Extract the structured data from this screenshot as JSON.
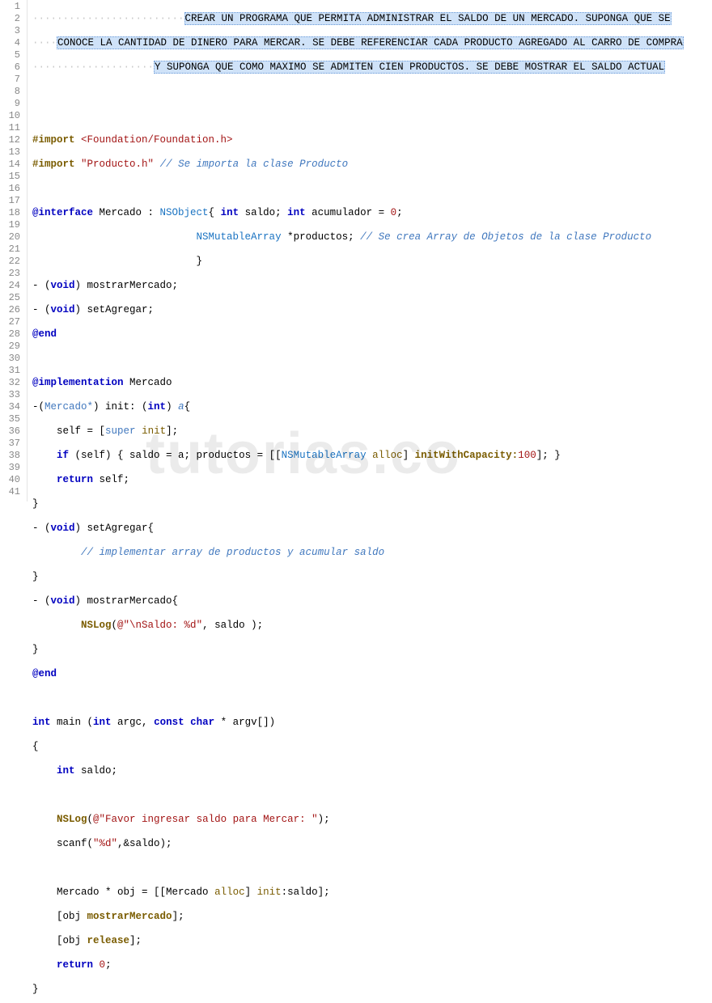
{
  "watermark": "tutorias.co",
  "gutter": {
    "start": 1,
    "end": 41
  },
  "comment_lines": [
    "CREAR UN PROGRAMA QUE PERMITA ADMINISTRAR EL SALDO DE UN MERCADO. SUPONGA QUE SE",
    "CONOCE LA CANTIDAD DE DINERO PARA MERCAR. SE DEBE REFERENCIAR CADA PRODUCTO AGREGADO AL CARRO DE COMPRA",
    "Y SUPONGA QUE COMO MAXIMO SE ADMITEN CIEN PRODUCTOS. SE DEBE MOSTRAR EL SALDO ACTUAL"
  ],
  "code": {
    "l6_import": "#import",
    "l6_header": "<Foundation/Foundation.h>",
    "l7_import": "#import",
    "l7_header": "\"Producto.h\"",
    "l7_cmt": "// Se importa la clase Producto",
    "l9_a": "@interface",
    "l9_b": " Mercado : ",
    "l9_c": "NSObject",
    "l9_d": "{ ",
    "l9_e": "int",
    "l9_f": " saldo; ",
    "l9_g": "int",
    "l9_h": " acumulador = ",
    "l9_i": "0",
    "l9_j": ";",
    "l10_a": "NSMutableArray",
    "l10_b": " *productos; ",
    "l10_c": "// Se crea Array de Objetos de la clase Producto",
    "l11": "}",
    "l12_a": "- (",
    "l12_b": "void",
    "l12_c": ") mostrarMercado;",
    "l13_a": "- (",
    "l13_b": "void",
    "l13_c": ") setAgregar;",
    "l14": "@end",
    "l16": "@implementation",
    "l16b": " Mercado",
    "l17_a": "-(",
    "l17_b": "Mercado*",
    "l17_c": ") init: (",
    "l17_d": "int",
    "l17_e": ") ",
    "l17_f": "a",
    "l17_g": "{",
    "l18_a": "self = [",
    "l18_b": "super",
    "l18_c": " ",
    "l18_d": "init",
    "l18_e": "];",
    "l19_a": "if",
    "l19_b": " (self) { saldo = a; productos = [[",
    "l19_c": "NSMutableArray",
    "l19_d": " ",
    "l19_e": "alloc",
    "l19_f": "] ",
    "l19_g": "initWithCapacity:",
    "l19_h": "100",
    "l19_i": "]; }",
    "l20_a": "return",
    "l20_b": " self;",
    "l21": "}",
    "l22_a": "- (",
    "l22_b": "void",
    "l22_c": ") setAgregar{",
    "l23": "// implementar array de productos y acumular saldo",
    "l24": "}",
    "l25_a": "- (",
    "l25_b": "void",
    "l25_c": ") mostrarMercado{",
    "l26_a": "NSLog",
    "l26_b": "(",
    "l26_c": "@\"\\nSaldo: %d\"",
    "l26_d": ", saldo );",
    "l27": "}",
    "l28": "@end",
    "l30_a": "int",
    "l30_b": " main (",
    "l30_c": "int",
    "l30_d": " argc, ",
    "l30_e": "const",
    "l30_f": " ",
    "l30_g": "char",
    "l30_h": " * argv[])",
    "l31": "{",
    "l32_a": "int",
    "l32_b": " saldo;",
    "l34_a": "NSLog",
    "l34_b": "(",
    "l34_c": "@\"Favor ingresar saldo para Mercar: \"",
    "l34_d": ");",
    "l35_a": "scanf(",
    "l35_b": "\"%d\"",
    "l35_c": ",&saldo);",
    "l37_a": "Mercado * obj = [[Mercado ",
    "l37_b": "alloc",
    "l37_c": "] ",
    "l37_d": "init",
    "l37_e": ":saldo];",
    "l38_a": "[obj ",
    "l38_b": "mostrarMercado",
    "l38_c": "];",
    "l39_a": "[obj ",
    "l39_b": "release",
    "l39_c": "];",
    "l40_a": "return",
    "l40_b": " ",
    "l40_c": "0",
    "l40_d": ";",
    "l41": "}"
  }
}
